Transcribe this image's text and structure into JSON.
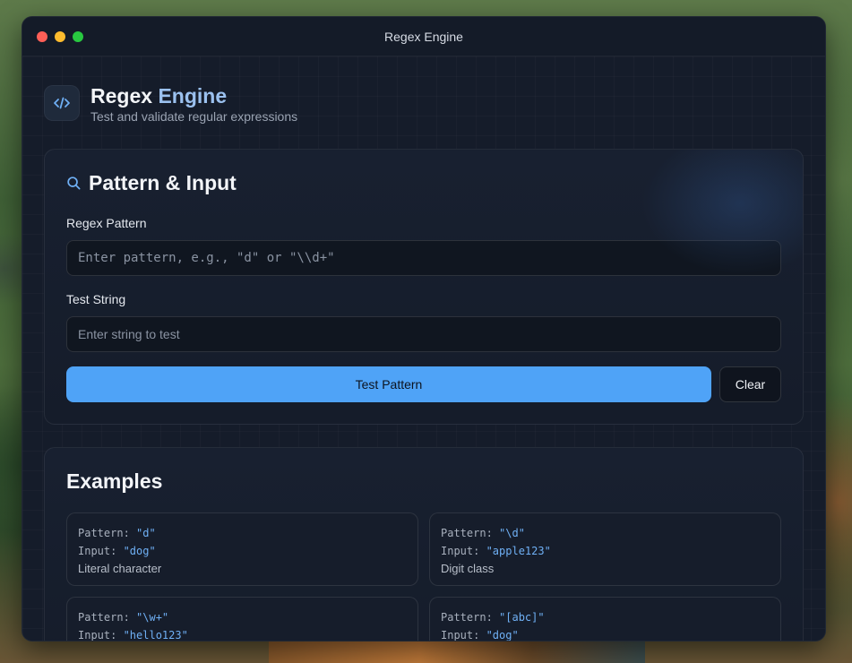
{
  "window": {
    "title": "Regex Engine"
  },
  "header": {
    "title_main": "Regex",
    "title_accent": "Engine",
    "subtitle": "Test and validate regular expressions",
    "logo_icon": "code-icon"
  },
  "pattern_card": {
    "title": "Pattern & Input",
    "icon": "search-icon",
    "pattern_label": "Regex Pattern",
    "pattern_placeholder": "Enter pattern, e.g., \"d\" or \"\\\\d+\"",
    "pattern_value": "",
    "test_label": "Test String",
    "test_placeholder": "Enter string to test",
    "test_value": "",
    "test_button": "Test Pattern",
    "clear_button": "Clear"
  },
  "examples": {
    "title": "Examples",
    "pattern_prefix": "Pattern: ",
    "input_prefix": "Input: ",
    "items": [
      {
        "pattern": "\"d\"",
        "input": "\"dog\"",
        "description": "Literal character"
      },
      {
        "pattern": "\"\\d\"",
        "input": "\"apple123\"",
        "description": "Digit class"
      },
      {
        "pattern": "\"\\w+\"",
        "input": "\"hello123\"",
        "description": ""
      },
      {
        "pattern": "\"[abc]\"",
        "input": "\"dog\"",
        "description": ""
      }
    ]
  },
  "colors": {
    "accent": "#4fa3f7",
    "title_accent": "#9bc1ef",
    "window_bg": "#141b28"
  }
}
